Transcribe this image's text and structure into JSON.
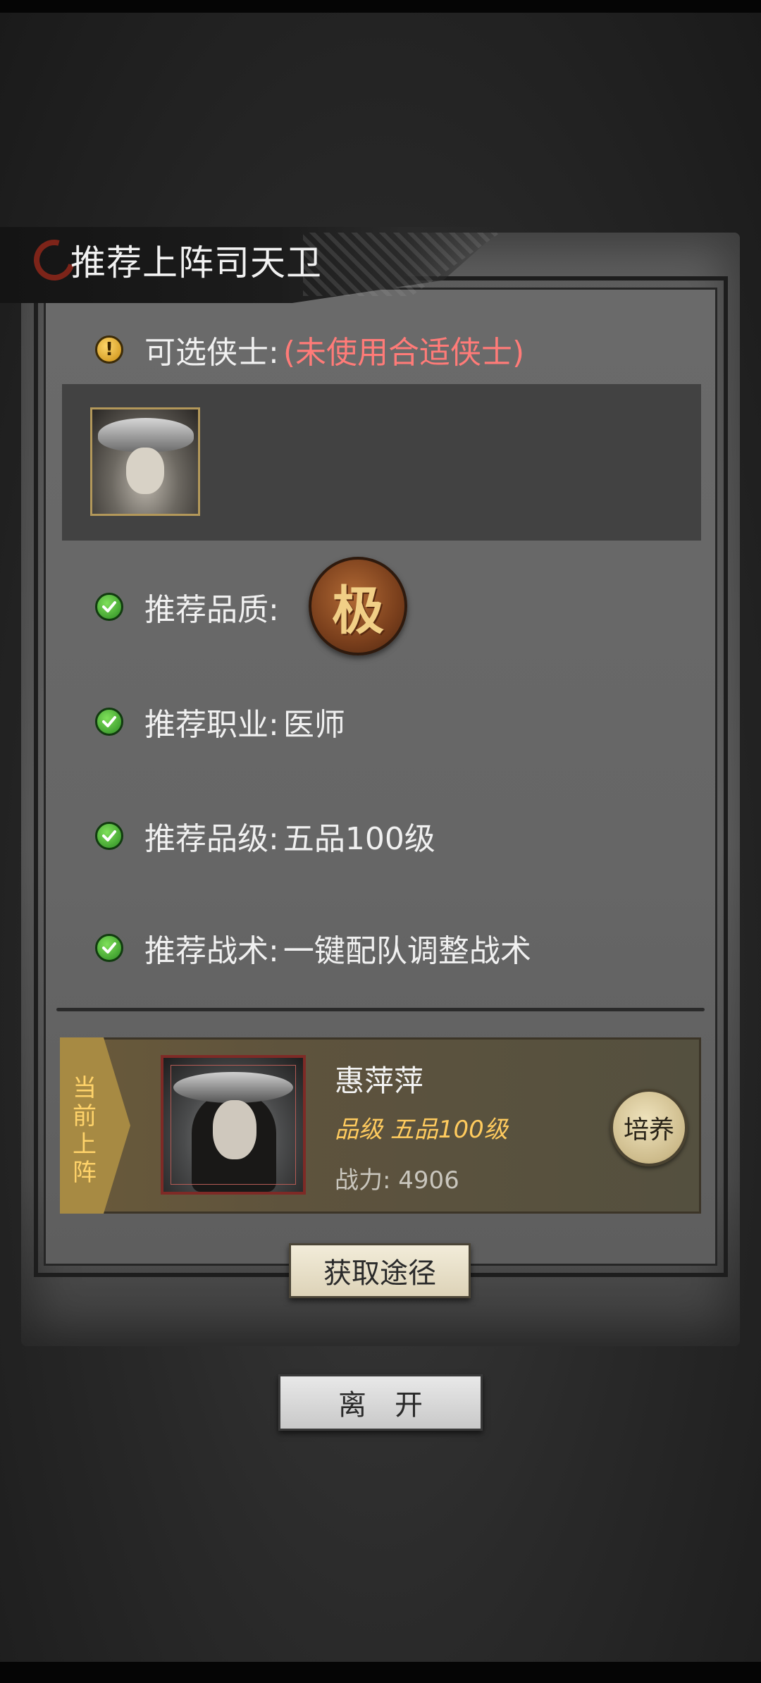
{
  "title": "推荐上阵司天卫",
  "criteria": {
    "heroes_label": "可选侠士:",
    "heroes_value": "(未使用合适侠士)",
    "quality_label": "推荐品质:",
    "quality_badge": "极",
    "profession_label": "推荐职业:",
    "profession_value": "医师",
    "rank_label": "推荐品级:",
    "rank_value": "五品100级",
    "tactics_label": "推荐战术:",
    "tactics_link": "一键配队",
    "tactics_suffix": "调整战术"
  },
  "current": {
    "tab_label": "当前上阵",
    "name": "惠萍萍",
    "grade": "品级 五品100级",
    "power": "战力: 4906",
    "train_button": "培养"
  },
  "buttons": {
    "acquire": "获取途径",
    "leave": "离开"
  },
  "icons": {
    "warning": "warning-icon",
    "check": "check-icon",
    "title": "ink-emblem-icon"
  },
  "colors": {
    "warning_red": "#ff7b78",
    "gold": "#ffd073",
    "check_green": "#2c8c22"
  }
}
